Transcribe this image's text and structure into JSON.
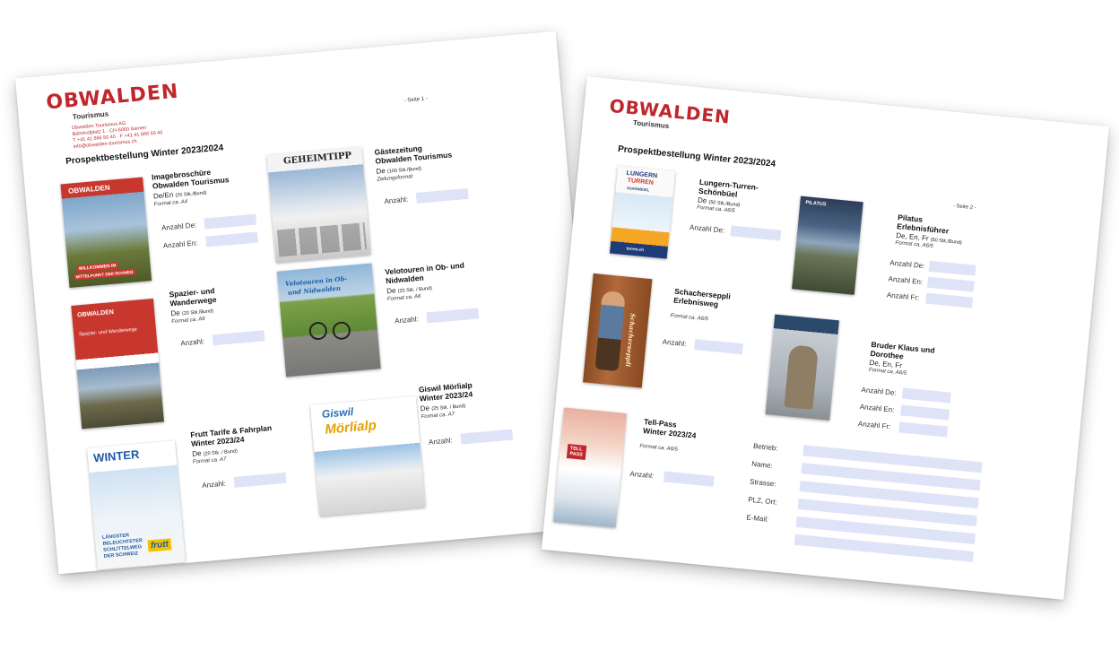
{
  "colors": {
    "brand_red": "#c0272d",
    "field_fill": "#dfe3f8"
  },
  "page1": {
    "logo": "OBWALDEN",
    "logo_sub": "Tourismus",
    "address": [
      "Obwalden Tourismus AG",
      "Bahnhofplatz 1 · CH-6060 Sarnen",
      "T +41 41 666 50 40 · F +41 41 666 50 45",
      "info@obwalden-tourismus.ch"
    ],
    "page_label": "- Seite 1 -",
    "title": "Prospektbestellung Winter 2023/2024",
    "items": [
      {
        "title": [
          "Imagebroschüre",
          "Obwalden Tourismus"
        ],
        "lang": "De/En",
        "qty": "(25 Stk./Bund)",
        "format": "Format ca. A4",
        "labels": [
          "Anzahl De:",
          "Anzahl En:"
        ],
        "cover_text": [
          "OBWALDEN",
          "WILLKOMMEN IM",
          "MITTELPUNKT DER SCHWEIZ"
        ]
      },
      {
        "title": [
          "Gästezeitung",
          "Obwalden Tourismus"
        ],
        "lang": "De",
        "qty": "(100 Stk./Bund)",
        "format": "Zeitungsformat",
        "labels": [
          "Anzahl:"
        ],
        "cover_text": [
          "GEHEIMTIPP"
        ]
      },
      {
        "title": [
          "Spazier- und",
          "Wanderwege"
        ],
        "lang": "De",
        "qty": "(20 Stk./Bund)",
        "format": "Format ca. A6",
        "labels": [
          "Anzahl:"
        ],
        "cover_text": [
          "OBWALDEN",
          "Spazier- und Wanderwege"
        ]
      },
      {
        "title": [
          "Velotouren in Ob- und",
          "Nidwalden"
        ],
        "lang": "De",
        "qty": "(25 Stk. / Bund)",
        "format": "Format ca. A6",
        "labels": [
          "Anzahl:"
        ],
        "cover_text": [
          "Velotouren in Ob-",
          "und Nidwalden"
        ]
      },
      {
        "title": [
          "Frutt Tarife & Fahrplan",
          "Winter 2023/24"
        ],
        "lang": "De",
        "qty": "(20 Stk. / Bund)",
        "format": "Format ca. A7",
        "labels": [
          "Anzahl:"
        ],
        "cover_text": [
          "WINTER",
          "LÄNGSTER",
          "BELEUCHTETER",
          "SCHLITTELWEG",
          "DER SCHWEIZ",
          "frutt"
        ]
      },
      {
        "title": [
          "Giswil Mörlialp",
          "Winter 2023/24"
        ],
        "lang": "De",
        "qty": "(25 Stk. / Bund)",
        "format": "Format ca. A7",
        "labels": [
          "Anzahl:"
        ],
        "cover_text": [
          "Giswil",
          "Mörlialp"
        ]
      }
    ]
  },
  "page2": {
    "logo": "OBWALDEN",
    "logo_sub": "Tourismus",
    "page_label": "- Seite 2 -",
    "title": "Prospektbestellung Winter 2023/2024",
    "items": [
      {
        "title": [
          "Lungern-Turren-",
          "Schönbüel"
        ],
        "lang": "De",
        "qty": "(50 Stk./Bund)",
        "format": "Format ca. A6/5",
        "labels": [
          "Anzahl De:"
        ],
        "cover_text": [
          "LUNGERN",
          "TURREN",
          "SCHÖNBÜEL",
          "turren.ch"
        ]
      },
      {
        "title": [
          "Pilatus",
          "Erlebnisführer"
        ],
        "lang": "De, En, Fr",
        "qty": "(50 Stk./Bund)",
        "format": "Format ca. A6/5",
        "labels": [
          "Anzahl De:",
          "Anzahl En:",
          "Anzahl Fr:"
        ],
        "cover_text": [
          "PILATUS"
        ]
      },
      {
        "title": [
          "Schacherseppli",
          "Erlebnisweg"
        ],
        "lang": "",
        "qty": "",
        "format": "Format ca. A6/5",
        "labels": [
          "Anzahl:"
        ],
        "cover_text": [
          "Schacherseppli"
        ]
      },
      {
        "title": [
          "Bruder Klaus und",
          "Dorothee"
        ],
        "lang": "De, En, Fr",
        "qty": "",
        "format": "Format ca. A6/5",
        "labels": [
          "Anzahl De:",
          "Anzahl En:",
          "Anzahl Fr:"
        ],
        "cover_text": []
      },
      {
        "title": [
          "Tell-Pass",
          "Winter 2023/24"
        ],
        "lang": "",
        "qty": "",
        "format": "Format ca. A6/5",
        "labels": [
          "Anzahl:"
        ],
        "cover_text": [
          "TELL",
          "PASS"
        ]
      }
    ],
    "contact_form": {
      "labels": [
        "Betrieb:",
        "Name:",
        "Strasse:",
        "PLZ, Ort:",
        "E-Mail:"
      ]
    }
  }
}
